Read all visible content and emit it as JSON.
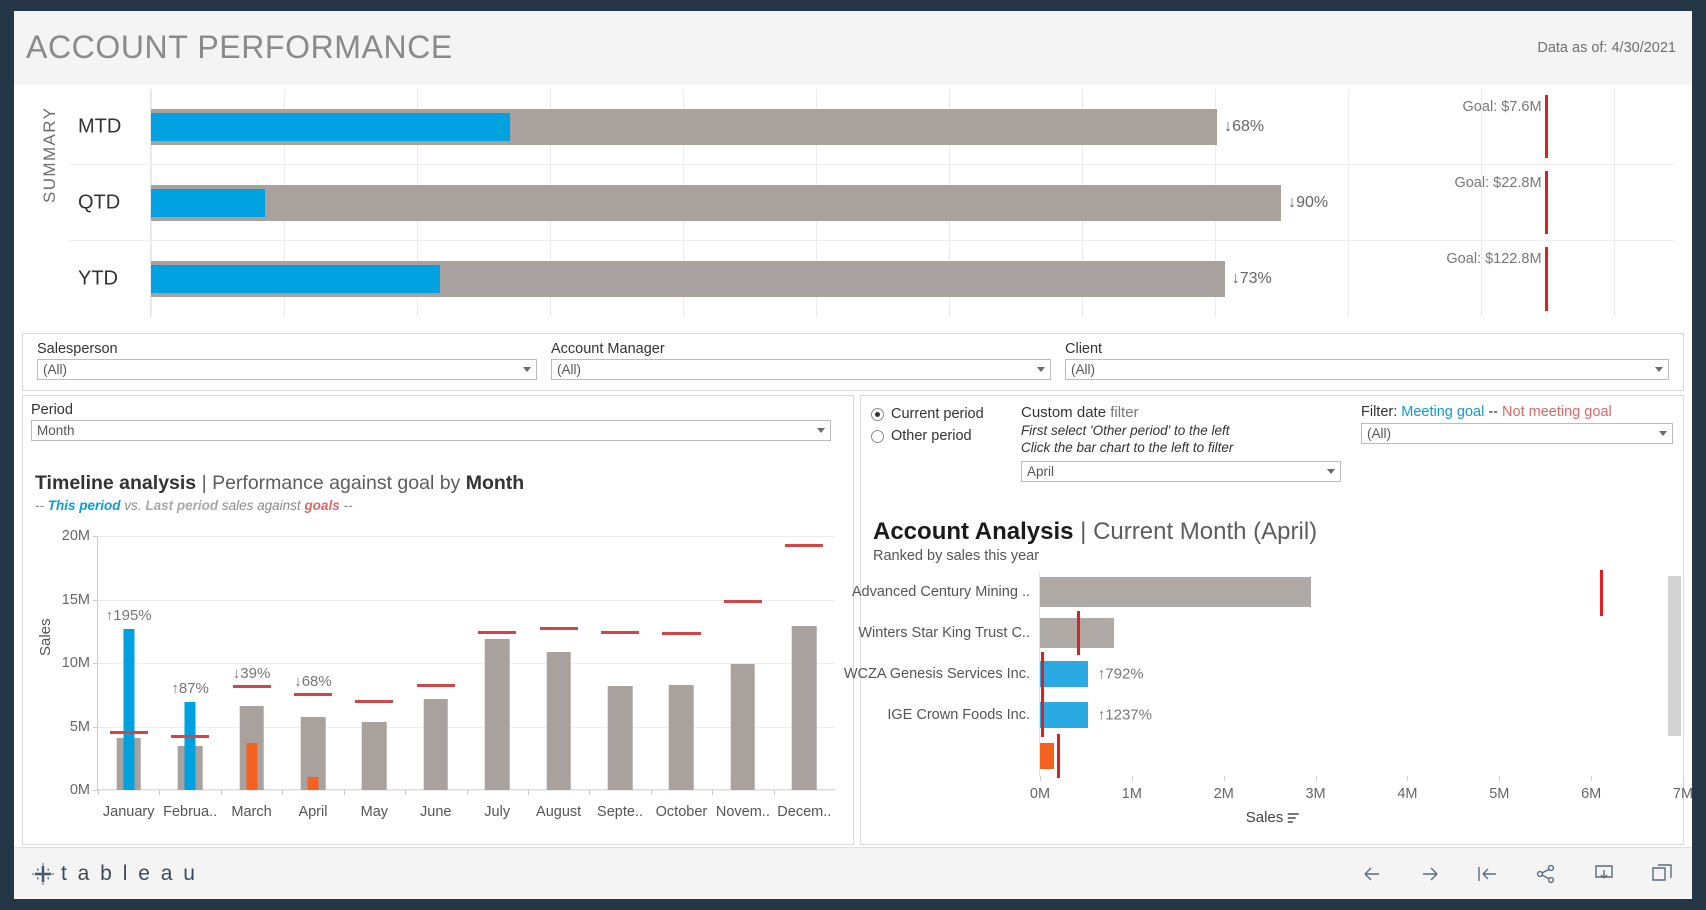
{
  "header": {
    "title": "ACCOUNT PERFORMANCE",
    "data_asof": "Data as of: 4/30/2021"
  },
  "summary": {
    "section_label": "SUMMARY",
    "rows": [
      {
        "label": "MTD",
        "actual_pct_of_axis": 0.236,
        "prior_pct_of_axis": 0.7,
        "delta": "↓68%",
        "goal_label": "Goal: $7.6M",
        "goal_pos": 0.915
      },
      {
        "label": "QTD",
        "actual_pct_of_axis": 0.075,
        "prior_pct_of_axis": 0.742,
        "delta": "↓90%",
        "goal_label": "Goal: $22.8M",
        "goal_pos": 0.915
      },
      {
        "label": "YTD",
        "actual_pct_of_axis": 0.19,
        "prior_pct_of_axis": 0.705,
        "delta": "↓73%",
        "goal_label": "Goal: $122.8M",
        "goal_pos": 0.915
      }
    ]
  },
  "filters": {
    "salesperson": {
      "label": "Salesperson",
      "value": "(All)"
    },
    "account_manager": {
      "label": "Account Manager",
      "value": "(All)"
    },
    "client": {
      "label": "Client",
      "value": "(All)"
    }
  },
  "left_panel": {
    "period": {
      "label": "Period",
      "value": "Month"
    },
    "title_bold": "Timeline analysis",
    "title_sep": "|",
    "title_rest": "Performance against goal by",
    "title_tail": "Month",
    "subtitle": {
      "prefix": "--",
      "this_period": "This period",
      "vs": "vs.",
      "last_period": "Last period",
      "mid": "sales against",
      "goals": "goals",
      "suffix": "--"
    }
  },
  "chart_data": {
    "type": "bar",
    "title": "Timeline analysis | Performance against goal by Month",
    "xlabel": "",
    "ylabel": "Sales",
    "ylim": [
      0,
      20000000
    ],
    "yticks": [
      "0M",
      "5M",
      "10M",
      "15M",
      "20M"
    ],
    "ytick_values": [
      0,
      5000000,
      10000000,
      15000000,
      20000000
    ],
    "grid": true,
    "legend": "This period (blue) vs Last period (grey) sales against goals (red)",
    "categories": [
      "January",
      "Februa..",
      "March",
      "April",
      "May",
      "June",
      "July",
      "August",
      "Septe..",
      "October",
      "Novem..",
      "Decem.."
    ],
    "series": [
      {
        "name": "Last period",
        "color": "#a8a19e",
        "values": [
          4100000,
          3450000,
          6650000,
          5750000,
          5350000,
          7200000,
          11900000,
          10900000,
          8200000,
          8250000,
          9900000,
          12900000
        ]
      },
      {
        "name": "This period",
        "color": "#00a1e0",
        "values": [
          12700000,
          6950000,
          3700000,
          1050000,
          null,
          null,
          null,
          null,
          null,
          null,
          null,
          null
        ]
      }
    ],
    "this_period_negative_color": "#f4621f",
    "this_period_negative_months": [
      "March",
      "April"
    ],
    "goals": [
      4500000,
      4200000,
      8100000,
      7500000,
      6900000,
      8200000,
      12400000,
      12700000,
      12350000,
      12300000,
      14800000,
      19250000
    ],
    "goal_color": "#cf4646",
    "data_labels": [
      {
        "category": "January",
        "text": "↑195%"
      },
      {
        "category": "Februa..",
        "text": "↑87%"
      },
      {
        "category": "March",
        "text": "↓39%"
      },
      {
        "category": "April",
        "text": "↓68%"
      }
    ]
  },
  "right_panel": {
    "radio": {
      "options": [
        "Current period",
        "Other period"
      ],
      "selected": "Current period"
    },
    "custom_date_filter": {
      "heading_bold": "Custom date",
      "heading_light": "filter",
      "instruction_1": "First select 'Other period' to the left",
      "instruction_2": "Click the bar chart to the left to filter",
      "value": "April"
    },
    "goal_filter": {
      "prefix": "Filter:",
      "meeting": "Meeting goal",
      "dash": "--",
      "not_meeting": "Not meeting goal",
      "value": "(All)"
    },
    "account_analysis": {
      "title_bold": "Account Analysis",
      "title_sep": "|",
      "title_rest": "Current Month (April)",
      "subtitle": "Ranked by sales this year"
    }
  },
  "account_chart": {
    "type": "bar",
    "title": "Account Analysis | Current Month (April)",
    "subtitle": "Ranked by sales this year",
    "xlabel": "Sales",
    "xlim": [
      0,
      7000000
    ],
    "xticks": [
      "0M",
      "1M",
      "2M",
      "3M",
      "4M",
      "5M",
      "6M",
      "7M"
    ],
    "xtick_values": [
      0,
      1000000,
      2000000,
      3000000,
      4000000,
      5000000,
      6000000,
      7000000
    ],
    "orientation": "horizontal",
    "rows": [
      {
        "name": "Advanced Century Mining ..",
        "value": 2950000,
        "color": "#b0aaa7",
        "goal": 6100000,
        "label": ""
      },
      {
        "name": "Winters Star King Trust C..",
        "value": 810000,
        "color": "#b0aaa7",
        "goal": 400000,
        "label": ""
      },
      {
        "name": "WCZA Genesis Services Inc.",
        "value": 520000,
        "color": "#2aaae2",
        "goal": 15000,
        "label": "↑792%"
      },
      {
        "name": "IGE Crown Foods Inc.",
        "value": 520000,
        "color": "#2aaae2",
        "goal": 15000,
        "label": "↑1237%"
      },
      {
        "name": "",
        "value": 150000,
        "color": "#f4621f",
        "goal": 190000,
        "label": ""
      }
    ]
  },
  "footer": {
    "logo_text": "t a b l e a u",
    "icons": [
      "back-arrow-icon",
      "forward-arrow-icon",
      "revert-icon",
      "share-icon",
      "download-icon",
      "fullscreen-icon"
    ]
  }
}
